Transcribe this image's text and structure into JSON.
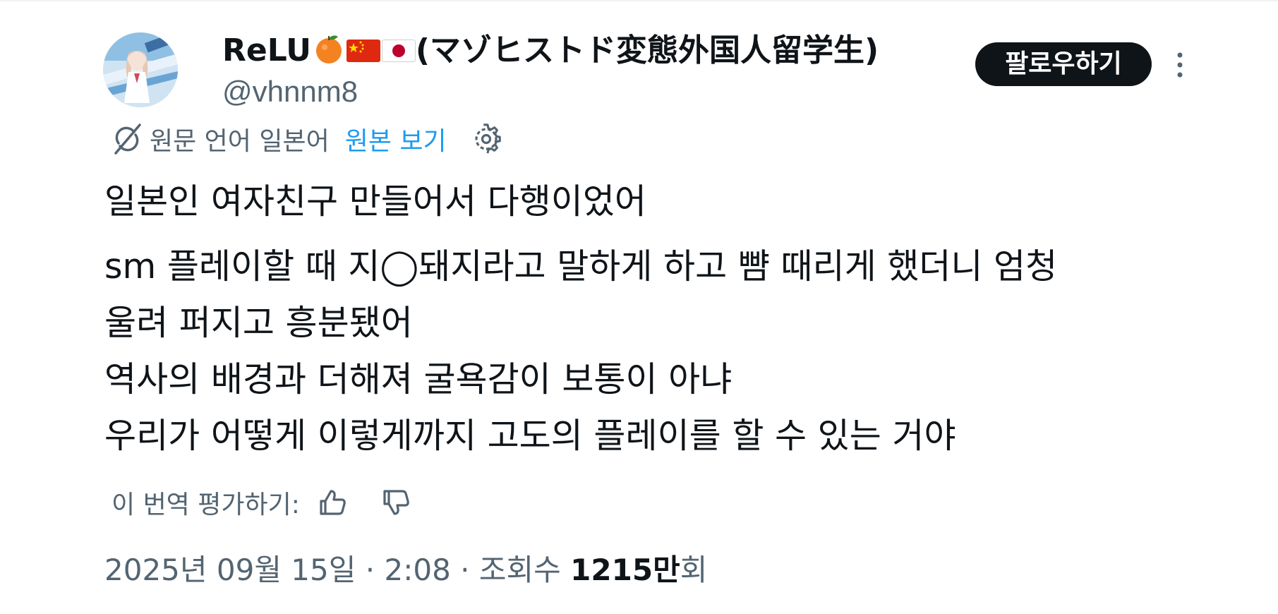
{
  "author": {
    "display_name": "ReLU",
    "display_name_suffix": "(マゾヒストド変態外国人留学生)",
    "emoji": [
      "tangerine-emoji",
      "china-flag-emoji",
      "japan-flag-emoji"
    ],
    "handle": "@vhnnm8"
  },
  "follow_button": {
    "label": "팔로우하기"
  },
  "more_menu": {
    "icon": "more-vertical-icon"
  },
  "translation": {
    "source_text": "원문 언어 일본어",
    "view_original_label": "원본 보기",
    "icons": [
      "translate-icon",
      "gear-icon"
    ]
  },
  "tweet": {
    "lines": [
      "일본인 여자친구 만들어서 다행이었어",
      "sm 플레이할 때 지◯돼지라고 말하게 하고 뺨 때리게 했더니 엄청",
      "울려 퍼지고 흥분됐어",
      "역사의 배경과 더해져 굴욕감이 보통이 아냐",
      "우리가 어떻게 이렇게까지 고도의 플레이를 할 수 있는 거야"
    ]
  },
  "rating": {
    "label": "이 번역 평가하기:",
    "icons": [
      "thumbs-up-icon",
      "thumbs-down-icon"
    ]
  },
  "meta": {
    "date": "2025년 09월 15일",
    "separator": "·",
    "time": "2:08",
    "views_label": "조회수",
    "views_count": "1215만",
    "views_unit": "회"
  },
  "colors": {
    "text": "#0f1419",
    "secondary": "#536471",
    "link": "#1d9bf0",
    "button_bg": "#0f1419"
  }
}
